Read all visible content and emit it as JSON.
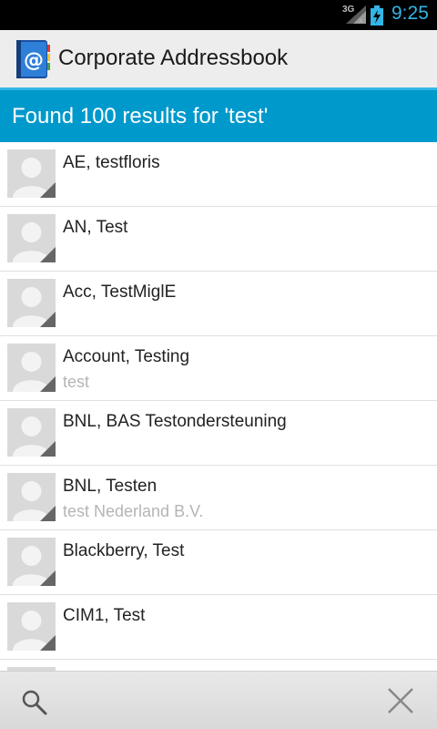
{
  "status_bar": {
    "network": "3G",
    "time": "9:25",
    "icons": [
      "signal-icon",
      "battery-charging-icon"
    ]
  },
  "app": {
    "title": "Corporate Addressbook",
    "icon": "addressbook-at-icon"
  },
  "results": {
    "header": "Found 100 results for 'test'"
  },
  "contacts": [
    {
      "name": "AE, testfloris",
      "sub": ""
    },
    {
      "name": "AN, Test",
      "sub": ""
    },
    {
      "name": "Acc, TestMiglE",
      "sub": ""
    },
    {
      "name": "Account, Testing",
      "sub": "test"
    },
    {
      "name": "BNL, BAS Testondersteuning",
      "sub": ""
    },
    {
      "name": "BNL, Testen",
      "sub": "test Nederland B.V."
    },
    {
      "name": "Blackberry, Test",
      "sub": ""
    },
    {
      "name": "CIM1, Test",
      "sub": ""
    },
    {
      "name": "",
      "sub": ""
    }
  ],
  "bottom_bar": {
    "icons": [
      "search-icon",
      "close-icon"
    ]
  },
  "colors": {
    "accent": "#33b5e5",
    "header_bg": "#0099cc",
    "action_bar_bg": "#ededed"
  }
}
